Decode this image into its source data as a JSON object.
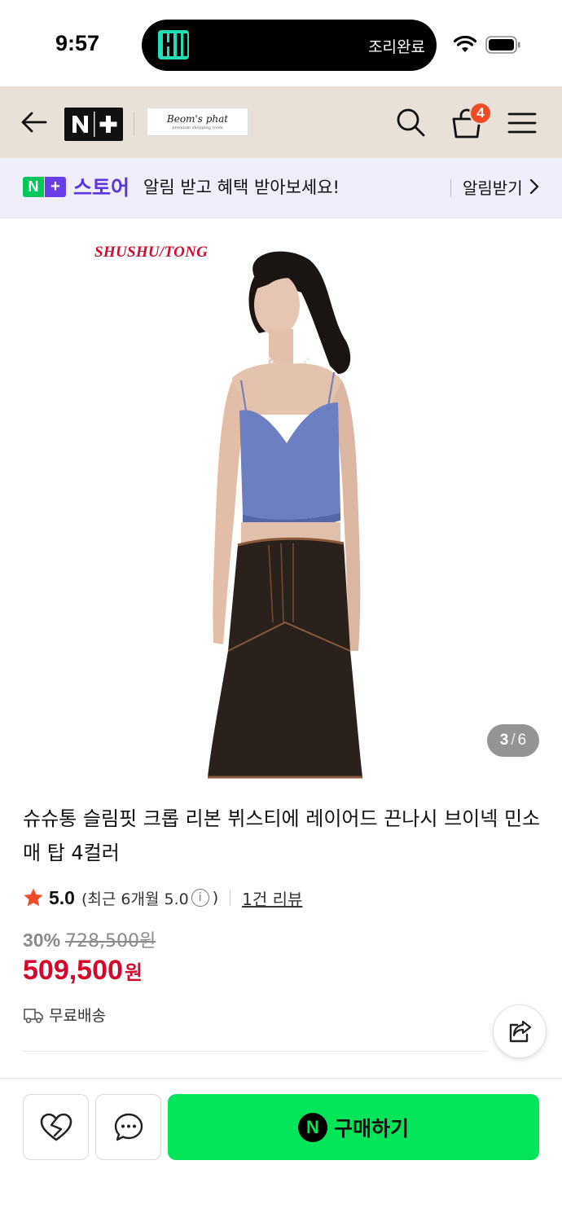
{
  "status_bar": {
    "time": "9:57",
    "island_activity": "조리완료"
  },
  "header": {
    "brand_logo_text": "Beom's phat",
    "brand_logo_subtext": "premium shopping room",
    "cart_count": "4"
  },
  "notification": {
    "store_n": "N",
    "store_plus": "+",
    "store_label": "스토어",
    "message": "알림 받고 혜택 받아보세요!",
    "action": "알림받기"
  },
  "product": {
    "brand_watermark": "SHUSHU/TONG",
    "image_index": "3",
    "image_total": "6",
    "title": "슈슈통 슬림핏 크롭 리본 뷔스티에 레이어드 끈나시 브이넥 민소매 탑 4컬러",
    "rating": "5.0",
    "rating_recent": "(최근 6개월 5.0",
    "rating_close": ")",
    "review_count": "1건 리뷰",
    "discount": "30%",
    "original_price": "728,500원",
    "sale_price": "509,500",
    "sale_unit": "원",
    "shipping": "무료배송"
  },
  "bottom_bar": {
    "buy_icon_letter": "N",
    "buy_label": "구매하기"
  },
  "colors": {
    "header_bg": "#e9e1d7",
    "banner_bg": "#f1eefc",
    "naver_green": "#03c75a",
    "buy_green": "#03e558",
    "price_red": "#d3082b",
    "badge_orange": "#f04b24",
    "store_purple": "#5a35e0"
  }
}
